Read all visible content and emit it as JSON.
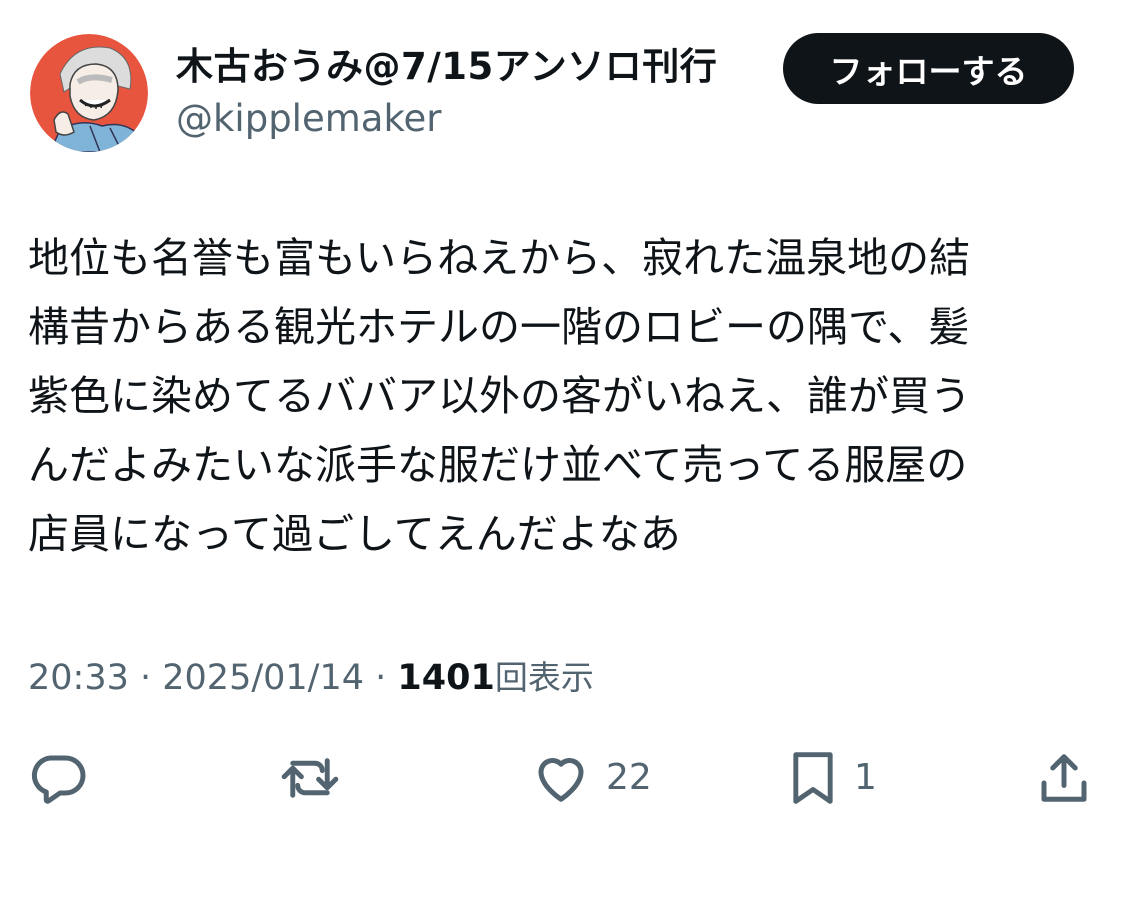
{
  "author": {
    "display_name": "木古おうみ@7/15アンソロ刊行",
    "handle": "@kipplemaker"
  },
  "follow_button_label": "フォローする",
  "tweet": {
    "lines": [
      "地位も名誉も富もいらねえから、寂れた温泉地の結",
      "構昔からある観光ホテルの一階のロビーの隅で、髪",
      "紫色に染めてるババア以外の客がいねえ、誰が買う",
      "んだよみたいな派手な服だけ並べて売ってる服屋の",
      "店員になって過ごしてえんだよなあ"
    ]
  },
  "meta": {
    "time": "20:33",
    "separator": " · ",
    "date": "2025/01/14",
    "views_count": "1401",
    "views_label": "回表示"
  },
  "actions": {
    "reply": {
      "icon": "reply-icon",
      "count": ""
    },
    "retweet": {
      "icon": "retweet-icon",
      "count": ""
    },
    "like": {
      "icon": "heart-icon",
      "count": "22"
    },
    "bookmark": {
      "icon": "bookmark-icon",
      "count": "1"
    },
    "share": {
      "icon": "share-icon",
      "count": ""
    }
  },
  "colors": {
    "text_primary": "#0f1419",
    "text_secondary": "#536471",
    "button_bg": "#0f1419",
    "button_text": "#ffffff",
    "avatar_bg": "#e8553f"
  }
}
